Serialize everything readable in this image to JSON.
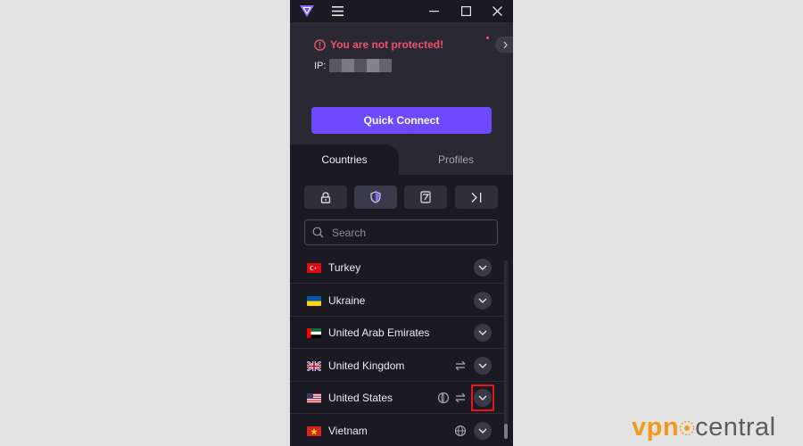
{
  "app": {
    "warning": "You are not protected!",
    "ip_label": "IP:",
    "quick_connect": "Quick Connect"
  },
  "tabs": {
    "countries": "Countries",
    "profiles": "Profiles"
  },
  "filters": [
    {
      "icon": "lock-icon"
    },
    {
      "icon": "shield-icon",
      "active": true
    },
    {
      "icon": "tor-icon"
    },
    {
      "icon": "p2p-icon"
    }
  ],
  "search": {
    "placeholder": "Search"
  },
  "countries": [
    {
      "name": "Turkey",
      "features": []
    },
    {
      "name": "Ukraine",
      "features": []
    },
    {
      "name": "United Arab Emirates",
      "features": []
    },
    {
      "name": "United Kingdom",
      "features": [
        "p2p"
      ]
    },
    {
      "name": "United States",
      "features": [
        "tor",
        "p2p"
      ],
      "highlighted": true
    },
    {
      "name": "Vietnam",
      "features": [
        "globe"
      ]
    }
  ],
  "watermark": {
    "vpn": "vpn",
    "central": "central"
  },
  "colors": {
    "accent": "#6d4aff",
    "warning": "#f0546a",
    "background": "#1b1a22",
    "highlight": "#e8141c",
    "watermark_orange": "#f39a1b"
  }
}
